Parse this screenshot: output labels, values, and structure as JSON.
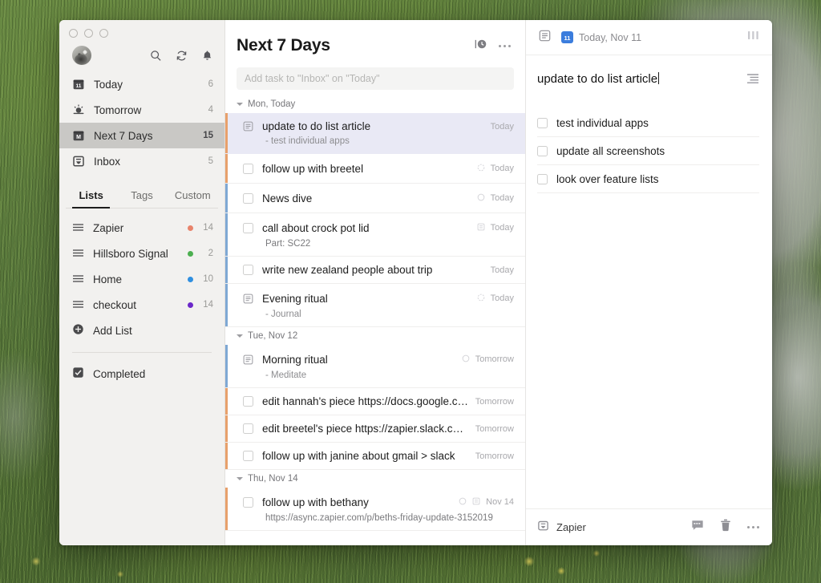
{
  "window": {
    "traffic_lights": [
      "close",
      "minimize",
      "maximize"
    ]
  },
  "sidebar": {
    "avatar_name": "user-avatar",
    "top_icons": [
      {
        "name": "search-icon",
        "label": "Search"
      },
      {
        "name": "sync-icon",
        "label": "Sync"
      },
      {
        "name": "notifications-bell-icon",
        "label": "Notifications"
      }
    ],
    "smart_lists": [
      {
        "label": "Today",
        "count": "6",
        "icon": "calendar-today-icon",
        "selected": false
      },
      {
        "label": "Tomorrow",
        "count": "4",
        "icon": "sunrise-icon",
        "selected": false
      },
      {
        "label": "Next 7 Days",
        "count": "15",
        "icon": "calendar-month-icon",
        "selected": true
      },
      {
        "label": "Inbox",
        "count": "5",
        "icon": "inbox-icon",
        "selected": false
      }
    ],
    "tabs": [
      {
        "label": "Lists",
        "active": true
      },
      {
        "label": "Tags",
        "active": false
      },
      {
        "label": "Custom",
        "active": false
      }
    ],
    "lists": [
      {
        "label": "Zapier",
        "count": "14",
        "color": "#e8836b"
      },
      {
        "label": "Hillsboro Signal",
        "count": "2",
        "color": "#4caf50"
      },
      {
        "label": "Home",
        "count": "10",
        "color": "#2f8fe0"
      },
      {
        "label": "checkout",
        "count": "14",
        "color": "#6b28c9"
      }
    ],
    "add_list_label": "Add List",
    "completed_label": "Completed"
  },
  "main": {
    "title": "Next 7 Days",
    "header_icons": [
      {
        "name": "history-clock-icon"
      },
      {
        "name": "more-options-icon"
      }
    ],
    "add_task_placeholder": "Add task to \"Inbox\" on \"Today\"",
    "groups": [
      {
        "day_label": "Mon, Today",
        "tasks": [
          {
            "title": "update to do list article",
            "subtitle": "- test individual apps",
            "date": "Today",
            "lead_icon": "note-document-icon",
            "meta_icons": [],
            "accent": "#e8a06b",
            "highlight": true
          },
          {
            "title": "follow up with breetel",
            "subtitle": "",
            "date": "Today",
            "lead_icon": "checkbox-icon",
            "meta_icons": [
              "recurring-icon"
            ],
            "accent": "#e8a06b",
            "highlight": false
          },
          {
            "title": "News dive",
            "subtitle": "",
            "date": "Today",
            "lead_icon": "checkbox-icon",
            "meta_icons": [
              "recurring-icon"
            ],
            "accent": "#7fa8d4",
            "highlight": false
          },
          {
            "title": "call about crock pot lid",
            "subtitle": "Part: SC22",
            "date": "Today",
            "lead_icon": "checkbox-icon",
            "meta_icons": [
              "note-badge-icon"
            ],
            "accent": "#7fa8d4",
            "highlight": false
          },
          {
            "title": "write new zealand people about trip",
            "subtitle": "",
            "date": "Today",
            "lead_icon": "checkbox-icon",
            "meta_icons": [],
            "accent": "#7fa8d4",
            "highlight": false
          },
          {
            "title": "Evening ritual",
            "subtitle": "- Journal",
            "date": "Today",
            "lead_icon": "note-document-icon",
            "meta_icons": [
              "recurring-icon"
            ],
            "accent": "#7fa8d4",
            "highlight": false
          }
        ]
      },
      {
        "day_label": "Tue, Nov 12",
        "tasks": [
          {
            "title": "Morning ritual",
            "subtitle": "- Meditate",
            "date": "Tomorrow",
            "lead_icon": "note-document-icon",
            "meta_icons": [
              "recurring-icon"
            ],
            "accent": "#7fa8d4",
            "highlight": false
          },
          {
            "title": "edit hannah's piece https://docs.google.com/...",
            "subtitle": "",
            "date": "Tomorrow",
            "lead_icon": "checkbox-icon",
            "meta_icons": [],
            "accent": "#e8a06b",
            "highlight": false
          },
          {
            "title": "edit breetel's piece https://zapier.slack.com/fi...",
            "subtitle": "",
            "date": "Tomorrow",
            "lead_icon": "checkbox-icon",
            "meta_icons": [],
            "accent": "#e8a06b",
            "highlight": false
          },
          {
            "title": "follow up with janine about gmail > slack",
            "subtitle": "",
            "date": "Tomorrow",
            "lead_icon": "checkbox-icon",
            "meta_icons": [],
            "accent": "#e8a06b",
            "highlight": false
          }
        ]
      },
      {
        "day_label": "Thu, Nov 14",
        "tasks": [
          {
            "title": "follow up with bethany",
            "subtitle": "https://async.zapier.com/p/beths-friday-update-3152019",
            "date": "Nov 14",
            "lead_icon": "checkbox-icon",
            "meta_icons": [
              "recurring-icon",
              "note-badge-icon"
            ],
            "accent": "#e8a06b",
            "highlight": false
          }
        ]
      }
    ]
  },
  "detail": {
    "header": {
      "note_icon": "note-document-icon",
      "date_badge_day": "11",
      "date_text": "Today, Nov 11",
      "priority_icon": "priority-bars-icon"
    },
    "title": "update to do list article",
    "description_icon": "description-lines-icon",
    "subtasks": [
      {
        "label": "test individual apps",
        "checked": false
      },
      {
        "label": "update all screenshots",
        "checked": false
      },
      {
        "label": "look over feature lists",
        "checked": false
      }
    ],
    "footer": {
      "list_icon": "list-inbox-icon",
      "list_name": "Zapier",
      "icons": [
        {
          "name": "comment-icon"
        },
        {
          "name": "trash-icon"
        },
        {
          "name": "more-options-icon"
        }
      ]
    }
  }
}
